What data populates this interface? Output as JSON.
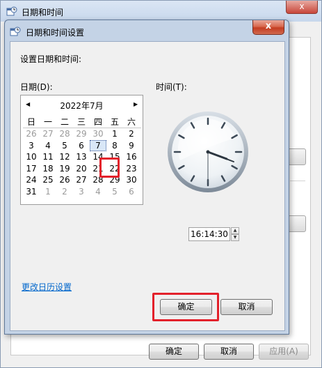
{
  "background_window": {
    "title": "日期和时间",
    "close_glyph": "x",
    "buttons": {
      "ok": "确定",
      "cancel": "取消",
      "apply": "应用(A)"
    }
  },
  "dialog": {
    "title": "日期和时间设置",
    "close_glyph": "x",
    "heading": "设置日期和时间:",
    "date_label": "日期(D):",
    "time_label": "时间(T):",
    "calendar": {
      "month_title": "2022年7月",
      "prev_glyph": "◀",
      "next_glyph": "▶",
      "weekdays": [
        "日",
        "一",
        "二",
        "三",
        "四",
        "五",
        "六"
      ],
      "weeks": [
        [
          "26",
          "27",
          "28",
          "29",
          "30",
          "1",
          "2"
        ],
        [
          "3",
          "4",
          "5",
          "6",
          "7",
          "8",
          "9"
        ],
        [
          "10",
          "11",
          "12",
          "13",
          "14",
          "15",
          "16"
        ],
        [
          "17",
          "18",
          "19",
          "20",
          "21",
          "22",
          "23"
        ],
        [
          "24",
          "25",
          "26",
          "27",
          "28",
          "29",
          "30"
        ],
        [
          "31",
          "1",
          "2",
          "3",
          "4",
          "5",
          "6"
        ]
      ],
      "selected_day": "7"
    },
    "time_value": "16:14:30",
    "spin_up_glyph": "▲",
    "spin_down_glyph": "▼",
    "change_calendar_link": "更改日历设置",
    "ok_button": "确定",
    "cancel_button": "取消"
  },
  "colors": {
    "highlight_red": "#e3212b",
    "link_blue": "#0066cc"
  }
}
